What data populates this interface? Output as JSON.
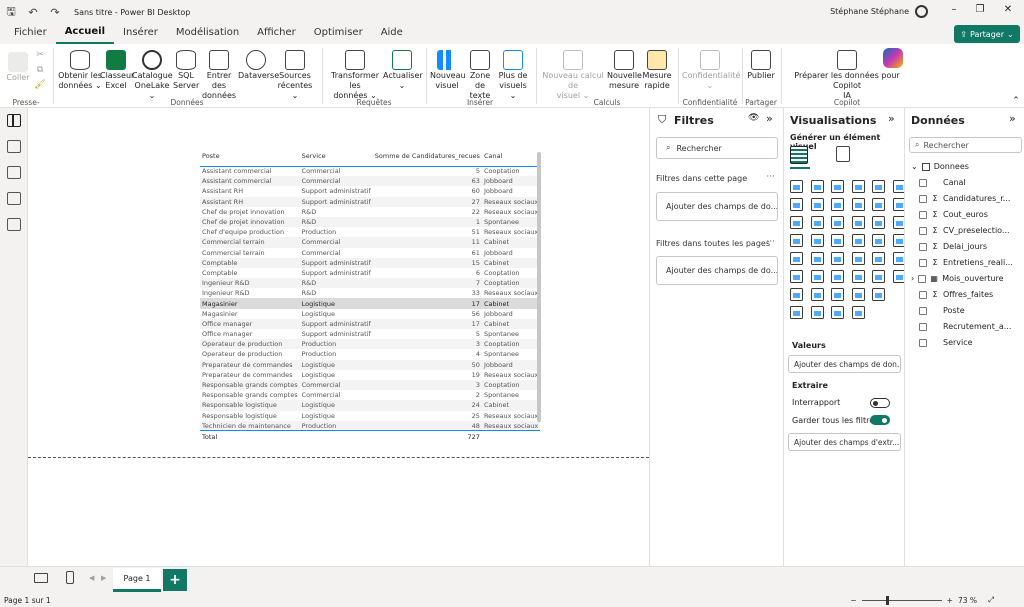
{
  "titlebar": {
    "app_title": "Sans titre - Power BI Desktop",
    "user": "Stéphane Stéphane"
  },
  "menu": [
    "Fichier",
    "Accueil",
    "Insérer",
    "Modélisation",
    "Afficher",
    "Optimiser",
    "Aide"
  ],
  "active_menu": "Accueil",
  "share_label": "Partager",
  "ribbon": {
    "coller": "Coller",
    "presse_papiers": "Presse-papiers",
    "obtenir1": "Obtenir les",
    "obtenir2": "données ⌄",
    "classeur1": "Classeur",
    "classeur2": "Excel",
    "catalogue1": "Catalogue",
    "catalogue2": "OneLake ⌄",
    "sql1": "SQL",
    "sql2": "Server",
    "entrer1": "Entrer des",
    "entrer2": "données",
    "dataverse": "Dataverse",
    "sources1": "Sources",
    "sources2": "récentes ⌄",
    "grp_donnees": "Données",
    "transformer1": "Transformer les",
    "transformer2": "données ⌄",
    "actualiser1": "Actualiser",
    "actualiser2": "⌄",
    "grp_requetes": "Requêtes",
    "nouveau_visuel1": "Nouveau",
    "nouveau_visuel2": "visuel",
    "zone_texte1": "Zone de",
    "zone_texte2": "texte",
    "plus_visuels1": "Plus de",
    "plus_visuels2": "visuels ⌄",
    "grp_inserer": "Insérer",
    "nouveau_calc1": "Nouveau calcul de",
    "nouveau_calc2": "visuel ⌄",
    "nouvelle_mesure1": "Nouvelle",
    "nouvelle_mesure2": "mesure",
    "mesure_rapide1": "Mesure",
    "mesure_rapide2": "rapide",
    "grp_calculs": "Calculs",
    "confidentialite1": "Confidentialité",
    "confidentialite2": "⌄",
    "grp_confidentialite": "Confidentialité",
    "publier": "Publier",
    "grp_partager": "Partager",
    "copilot1": "Préparer les données pour Copilot",
    "copilot2": "IA",
    "grp_copilot": "Copilot"
  },
  "table": {
    "headers": [
      "Poste",
      "Service",
      "Somme de Candidatures_recues",
      "Canal"
    ],
    "rows": [
      [
        "Assistant commercial",
        "Commercial",
        "5",
        "Cooptation"
      ],
      [
        "Assistant commercial",
        "Commercial",
        "63",
        "Jobboard"
      ],
      [
        "Assistant RH",
        "Support administratif",
        "60",
        "Jobboard"
      ],
      [
        "Assistant RH",
        "Support administratif",
        "27",
        "Reseaux sociaux"
      ],
      [
        "Chef de projet innovation",
        "R&D",
        "22",
        "Reseaux sociaux"
      ],
      [
        "Chef de projet innovation",
        "R&D",
        "1",
        "Spontanee"
      ],
      [
        "Chef d'equipe production",
        "Production",
        "51",
        "Reseaux sociaux"
      ],
      [
        "Commercial terrain",
        "Commercial",
        "11",
        "Cabinet"
      ],
      [
        "Commercial terrain",
        "Commercial",
        "61",
        "Jobboard"
      ],
      [
        "Comptable",
        "Support administratif",
        "15",
        "Cabinet"
      ],
      [
        "Comptable",
        "Support administratif",
        "6",
        "Cooptation"
      ],
      [
        "Ingenieur R&D",
        "R&D",
        "7",
        "Cooptation"
      ],
      [
        "Ingenieur R&D",
        "R&D",
        "33",
        "Reseaux sociaux"
      ],
      [
        "Magasinier",
        "Logistique",
        "17",
        "Cabinet"
      ],
      [
        "Magasinier",
        "Logistique",
        "56",
        "Jobboard"
      ],
      [
        "Office manager",
        "Support administratif",
        "17",
        "Cabinet"
      ],
      [
        "Office manager",
        "Support administratif",
        "5",
        "Spontanee"
      ],
      [
        "Operateur de production",
        "Production",
        "3",
        "Cooptation"
      ],
      [
        "Operateur de production",
        "Production",
        "4",
        "Spontanee"
      ],
      [
        "Preparateur de commandes",
        "Logistique",
        "50",
        "Jobboard"
      ],
      [
        "Preparateur de commandes",
        "Logistique",
        "19",
        "Reseaux sociaux"
      ],
      [
        "Responsable grands comptes",
        "Commercial",
        "3",
        "Cooptation"
      ],
      [
        "Responsable grands comptes",
        "Commercial",
        "2",
        "Spontanee"
      ],
      [
        "Responsable logistique",
        "Logistique",
        "24",
        "Cabinet"
      ],
      [
        "Responsable logistique",
        "Logistique",
        "25",
        "Reseaux sociaux"
      ],
      [
        "Technicien de maintenance",
        "Production",
        "48",
        "Reseaux sociaux"
      ]
    ],
    "total_label": "Total",
    "total_value": "727"
  },
  "filters": {
    "title": "Filtres",
    "search_placeholder": "Rechercher",
    "page_section": "Filtres dans cette page",
    "page_well": "Ajouter des champs de do...",
    "all_section": "Filtres dans toutes les pages",
    "all_well": "Ajouter des champs de do..."
  },
  "visualizations": {
    "title": "Visualisations",
    "subtitle": "Générer un élément visuel",
    "valeurs_label": "Valeurs",
    "valeurs_well": "Ajouter des champs de don...",
    "extraire_label": "Extraire",
    "interrapport": "Interrapport",
    "garder_filtres": "Garder tous les filtres",
    "extraire_well": "Ajouter des champs d'extr..."
  },
  "data_panel": {
    "title": "Données",
    "search_placeholder": "Rechercher",
    "table_name": "Donnees",
    "fields": [
      {
        "name": "Canal",
        "sigma": false
      },
      {
        "name": "Candidatures_r...",
        "sigma": true
      },
      {
        "name": "Cout_euros",
        "sigma": true
      },
      {
        "name": "CV_preselectio...",
        "sigma": true
      },
      {
        "name": "Delai_jours",
        "sigma": true
      },
      {
        "name": "Entretiens_reali...",
        "sigma": true
      },
      {
        "name": "Mois_ouverture",
        "sigma": false,
        "expandable": true
      },
      {
        "name": "Offres_faites",
        "sigma": true
      },
      {
        "name": "Poste",
        "sigma": false
      },
      {
        "name": "Recrutement_a...",
        "sigma": false
      },
      {
        "name": "Service",
        "sigma": false
      }
    ]
  },
  "pages": {
    "tab": "Page 1",
    "add": "+"
  },
  "status": {
    "page_info": "Page 1 sur 1",
    "zoom": "73 %"
  },
  "colors": {
    "accent": "#117865",
    "table_line": "#118dff"
  }
}
